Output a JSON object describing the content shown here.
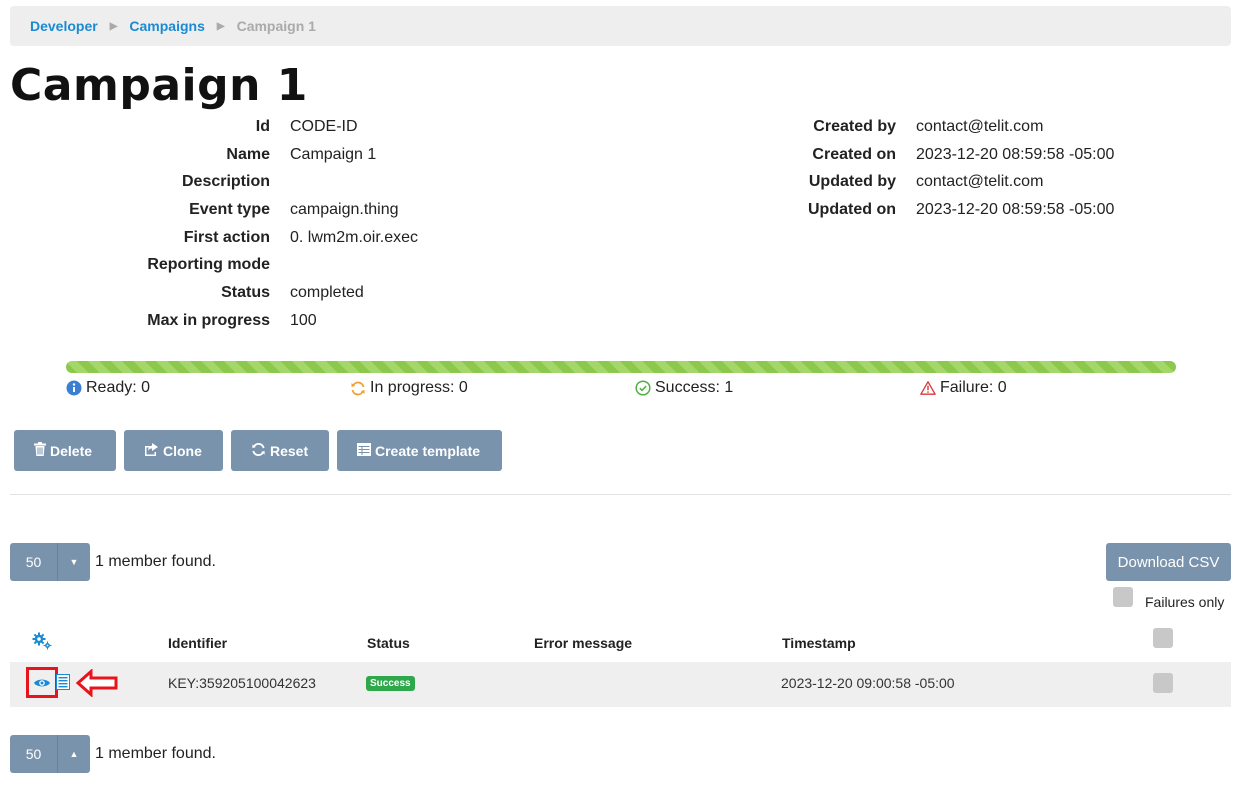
{
  "breadcrumb": {
    "items": [
      "Developer",
      "Campaigns"
    ],
    "current": "Campaign 1"
  },
  "page_title": "Campaign 1",
  "details_left": [
    {
      "label": "Id",
      "value": "CODE-ID"
    },
    {
      "label": "Name",
      "value": "Campaign 1"
    },
    {
      "label": "Description",
      "value": ""
    },
    {
      "label": "Event type",
      "value": "campaign.thing"
    },
    {
      "label": "First action",
      "value": "0. lwm2m.oir.exec"
    },
    {
      "label": "Reporting mode",
      "value": ""
    },
    {
      "label": "Status",
      "value": "completed"
    },
    {
      "label": "Max in progress",
      "value": "100"
    }
  ],
  "details_right": [
    {
      "label": "Created by",
      "value": "contact@telit.com"
    },
    {
      "label": "Created on",
      "value": "2023-12-20 08:59:58 -05:00"
    },
    {
      "label": "Updated by",
      "value": "contact@telit.com"
    },
    {
      "label": "Updated on",
      "value": "2023-12-20 08:59:58 -05:00"
    }
  ],
  "progress": {
    "success_fraction": 1.0,
    "color": "#8cc84b",
    "ready": "Ready: 0",
    "in_progress": "In progress: 0",
    "success": "Success: 1",
    "failure": "Failure: 0"
  },
  "actions": {
    "delete": "Delete",
    "clone": "Clone",
    "reset": "Reset",
    "create_template": "Create template"
  },
  "pager_top": {
    "page_size": "50",
    "found": "1 member found."
  },
  "pager_bottom": {
    "page_size": "50",
    "found": "1 member found."
  },
  "download_csv": "Download CSV",
  "failures_only": "Failures only",
  "table": {
    "headers": {
      "identifier": "Identifier",
      "status": "Status",
      "error": "Error message",
      "timestamp": "Timestamp"
    },
    "rows": [
      {
        "identifier": "KEY:359205100042623",
        "status": "Success",
        "error": "",
        "timestamp": "2023-12-20 09:00:58 -05:00"
      }
    ]
  },
  "colors": {
    "accent": "#1a8bd3",
    "button": "#7a93ad",
    "success_badge": "#2ea84a",
    "annotation": "#e8141c"
  }
}
